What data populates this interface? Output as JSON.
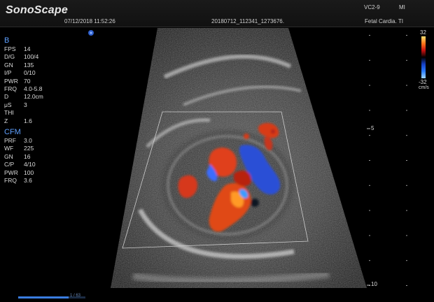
{
  "header": {
    "brand": "SonoScape",
    "datetime": "07/12/2018 11:52:26",
    "study_id": "20180712_112341_1273676.",
    "probe": "VC2-9",
    "mi_label": "MI",
    "preset": "Fetal Cardia. TI"
  },
  "b_mode": {
    "title": "B",
    "params": [
      {
        "key": "FPS",
        "value": "14"
      },
      {
        "key": "D/G",
        "value": "100/4"
      },
      {
        "key": "GN",
        "value": "135"
      },
      {
        "key": "I/P",
        "value": "0/10"
      },
      {
        "key": "PWR",
        "value": "70"
      },
      {
        "key": "FRQ",
        "value": "4.0-5.8"
      },
      {
        "key": "D",
        "value": "12.0cm"
      },
      {
        "key": "μS",
        "value": "3"
      },
      {
        "key": "THI",
        "value": ""
      },
      {
        "key": "Z",
        "value": "1.6"
      }
    ]
  },
  "cfm_mode": {
    "title": "CFM",
    "params": [
      {
        "key": "PRF",
        "value": "3.0"
      },
      {
        "key": "WF",
        "value": "225"
      },
      {
        "key": "GN",
        "value": "16"
      },
      {
        "key": "C/P",
        "value": "4/10"
      },
      {
        "key": "PWR",
        "value": "100"
      },
      {
        "key": "FRQ",
        "value": "3.6"
      }
    ]
  },
  "color_scale": {
    "max": "32",
    "min": "-32",
    "unit": "cm/s",
    "colors": [
      "#ffe070",
      "#ff7a1a",
      "#c81010",
      "#000000",
      "#1640c8",
      "#2a7cff",
      "#9fd6ff"
    ]
  },
  "depth_scale": {
    "mid_label": "5",
    "bottom_label": "10"
  },
  "cine": {
    "position_label": "1 / 63",
    "fraction": 0.75
  },
  "icons": {
    "orientation_marker": "orientation-marker-icon"
  }
}
